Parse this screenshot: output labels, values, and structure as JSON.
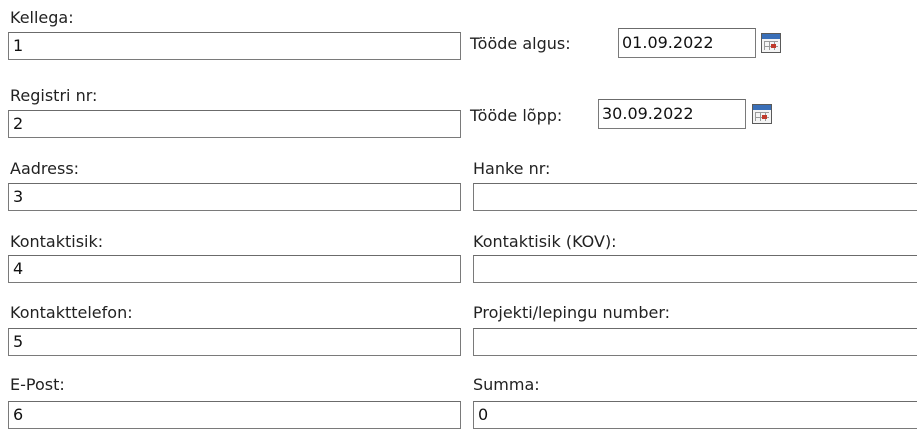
{
  "left_column": [
    {
      "label": "Kellega:",
      "value": "1"
    },
    {
      "label": "Registri nr:",
      "value": "2"
    },
    {
      "label": "Aadress:",
      "value": "3"
    },
    {
      "label": "Kontaktisik:",
      "value": "4"
    },
    {
      "label": "Kontakttelefon:",
      "value": "5"
    },
    {
      "label": "E-Post:",
      "value": "6"
    }
  ],
  "dates": {
    "start_label": "Tööde algus:",
    "start_value": "01.09.2022",
    "end_label": "Tööde lõpp:",
    "end_value": "30.09.2022",
    "icon": "calendar-icon"
  },
  "right_column": [
    {
      "label": "Hanke nr:",
      "value": ""
    },
    {
      "label": "Kontaktisik (KOV):",
      "value": ""
    },
    {
      "label": "Projekti/lepingu number:",
      "value": ""
    },
    {
      "label": "Summa:",
      "value": "0"
    }
  ]
}
